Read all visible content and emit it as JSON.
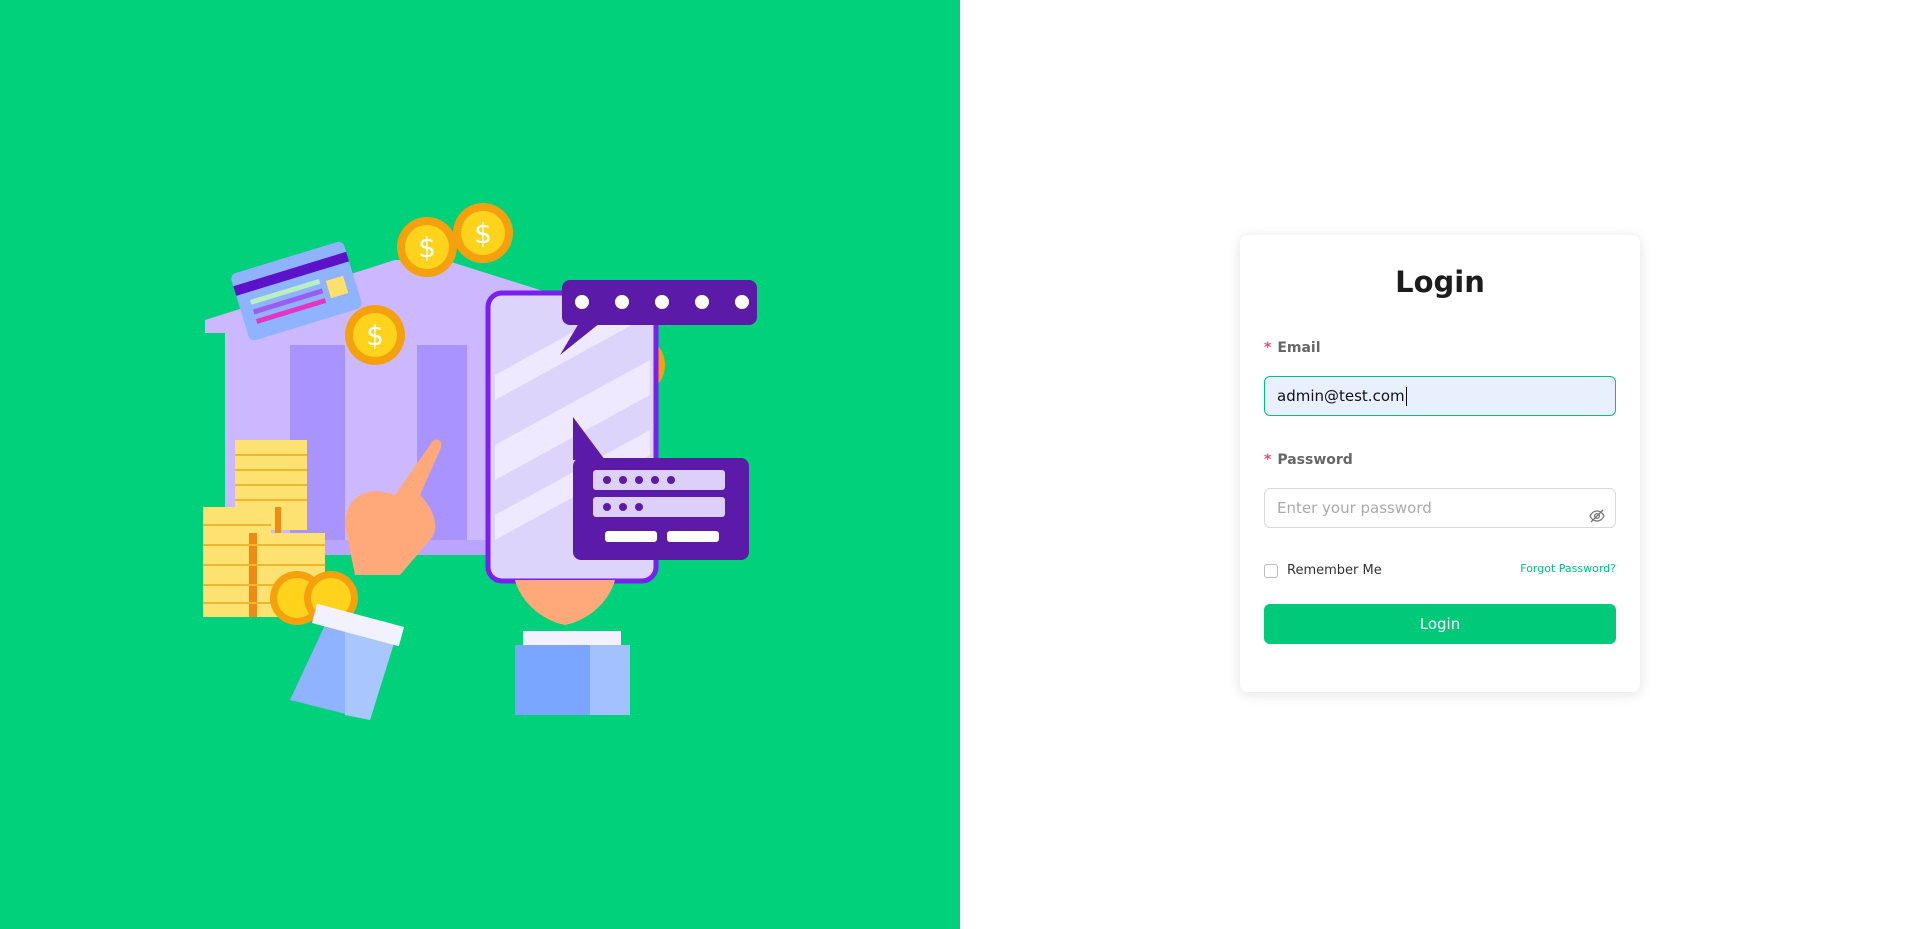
{
  "colors": {
    "brand": "#00d17a",
    "accent": "#00c97a",
    "required": "#ef4a6a"
  },
  "illustration": {
    "icon": "bank-mobile-payment-illustration"
  },
  "login": {
    "title": "Login",
    "email": {
      "required_mark": "*",
      "label": "Email",
      "value": "admin@test.com"
    },
    "password": {
      "required_mark": "*",
      "label": "Password",
      "placeholder": "Enter your password",
      "toggle_icon": "eye-slash-icon"
    },
    "remember_label": "Remember Me",
    "remember_checked": false,
    "forgot_label": "Forgot Password?",
    "submit_label": "Login"
  }
}
